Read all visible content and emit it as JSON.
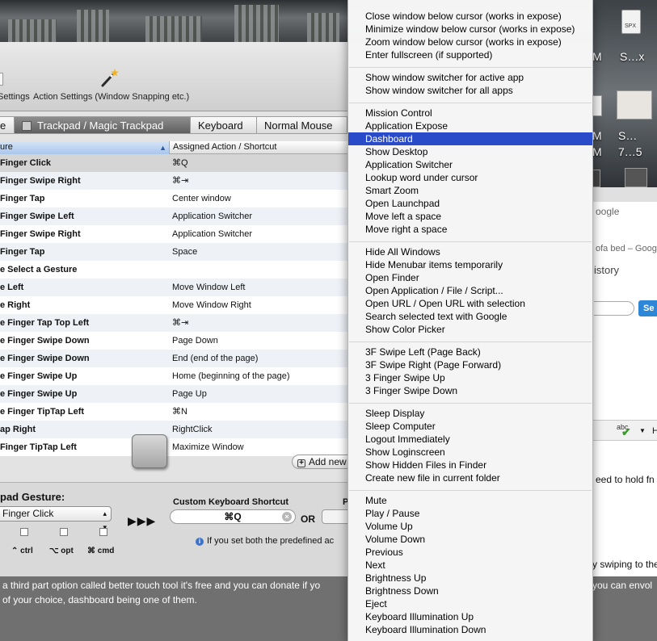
{
  "desktop": {
    "labels": [
      "M",
      "S…x",
      "M",
      "S…",
      "M",
      "7…5"
    ],
    "spx_label": "SPX"
  },
  "btt": {
    "toolbar": {
      "settings_label": "Settings",
      "action_settings_label": "Action Settings (Window Snapping etc.)"
    },
    "tabs": [
      {
        "label": "e",
        "active": false
      },
      {
        "label": "Trackpad / Magic Trackpad",
        "active": true
      },
      {
        "label": "Keyboard",
        "active": false
      },
      {
        "label": "Normal Mouse",
        "active": false
      }
    ],
    "table": {
      "col_gesture": "ure",
      "col_action": "Assigned Action / Shortcut",
      "rows": [
        {
          "gesture": "Finger Click",
          "action": "⌘Q",
          "selected": true
        },
        {
          "gesture": "Finger Swipe Right",
          "action": "⌘⇥",
          "selected": false
        },
        {
          "gesture": "Finger Tap",
          "action": "Center window",
          "selected": false
        },
        {
          "gesture": "Finger Swipe Left",
          "action": "Application Switcher",
          "selected": false
        },
        {
          "gesture": "Finger Swipe Right",
          "action": "Application Switcher",
          "selected": false
        },
        {
          "gesture": "Finger Tap",
          "action": "Space",
          "selected": false
        },
        {
          "gesture": "e Select a Gesture",
          "action": "",
          "selected": false
        },
        {
          "gesture": "e Left",
          "action": "Move Window Left",
          "selected": false
        },
        {
          "gesture": "e Right",
          "action": "Move Window Right",
          "selected": false
        },
        {
          "gesture": "e Finger Tap Top Left",
          "action": "⌘⇥",
          "selected": false
        },
        {
          "gesture": "e Finger Swipe Down",
          "action": "Page Down",
          "selected": false
        },
        {
          "gesture": "e Finger Swipe Down",
          "action": "End (end of the page)",
          "selected": false
        },
        {
          "gesture": "e Finger Swipe Up",
          "action": "Home (beginning of the page)",
          "selected": false
        },
        {
          "gesture": "e Finger Swipe Up",
          "action": "Page Up",
          "selected": false
        },
        {
          "gesture": "e Finger TipTap Left",
          "action": "⌘N",
          "selected": false
        },
        {
          "gesture": "ap Right",
          "action": "RightClick",
          "selected": false
        },
        {
          "gesture": "Finger TipTap Left",
          "action": "Maximize Window",
          "selected": false
        }
      ]
    },
    "add_new_label": "Add new",
    "edit": {
      "title": "pad Gesture:",
      "finger_select_value": "Finger Click",
      "modifiers": [
        "⌃ ctrl",
        "⌥ opt",
        "⌘ cmd"
      ],
      "arrows": "▶▶▶",
      "kbd_title": "Custom Keyboard Shortcut",
      "kbd_value": "⌘Q",
      "kbd_clear": "×",
      "or_label": "OR",
      "predef_title": "P",
      "info_icon": "i",
      "info_text": "If you set both the predefined ac"
    }
  },
  "article": {
    "line1": "a third part option called better touch tool it's free and you can donate if yo",
    "line2": " of your choice, dashboard being one of them.",
    "right_fragment": "you can envol"
  },
  "browser": {
    "google_placeholder": "oogle",
    "result_title": "ofa bed – Goog",
    "history": "istory",
    "search_button": "Se",
    "hold_fn": "eed to hold fn a",
    "swiping": "y swiping to the le",
    "abc": "abc",
    "h_letter": "H"
  },
  "menu": {
    "highlight_color": "#2a4bc9",
    "groups": [
      [
        "Close window below cursor (works in expose)",
        "Minimize window below cursor (works in expose)",
        "Zoom window below cursor (works in expose)",
        "Enter fullscreen (if supported)"
      ],
      [
        "Show window switcher for active app",
        "Show window switcher for all apps"
      ],
      [
        "Mission Control",
        "Application Expose",
        "Dashboard",
        "Show Desktop",
        "Application Switcher",
        "Lookup word under cursor",
        "Smart Zoom",
        "Open Launchpad",
        "Move left a space",
        "Move right a space"
      ],
      [
        "Hide All Windows",
        "Hide Menubar items temporarily",
        "Open Finder",
        "Open Application / File / Script...",
        "Open URL / Open URL with selection",
        "Search selected text with Google",
        "Show Color Picker"
      ],
      [
        "3F Swipe Left (Page Back)",
        "3F Swipe Right (Page Forward)",
        "3 Finger Swipe Up",
        "3 Finger Swipe Down"
      ],
      [
        "Sleep Display",
        "Sleep Computer",
        "Logout Immediately",
        "Show Loginscreen",
        "Show Hidden Files in Finder",
        "Create new file in current folder"
      ],
      [
        "Mute",
        "Play / Pause",
        "Volume Up",
        "Volume Down",
        "Previous",
        "Next",
        "Brightness Up",
        "Brightness Down",
        "Eject",
        "Keyboard Illumination Up",
        "Keyboard Illumination Down"
      ]
    ],
    "highlighted": "Dashboard"
  }
}
